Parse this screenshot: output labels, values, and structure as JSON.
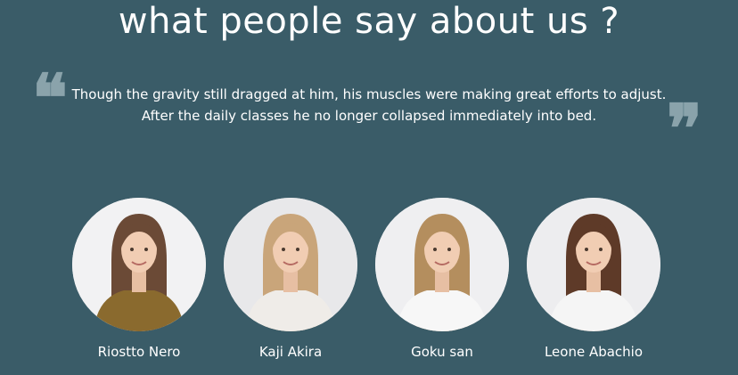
{
  "section": {
    "title": "what people say about us ?",
    "quote": "Though the gravity still dragged at him, his muscles were making great efforts to adjust. After the daily classes he no longer collapsed immediately into bed."
  },
  "colors": {
    "background": "#3a5c68",
    "quote_mark": "#8aa3ab",
    "text": "#ffffff"
  },
  "icons": {
    "open_quote": "quote-open-icon",
    "close_quote": "quote-close-icon"
  },
  "testimonials": [
    {
      "name": "Riostto Nero",
      "hair": "#6b4a36",
      "top": "#8a6a2e",
      "bg": "#f2f2f3"
    },
    {
      "name": "Kaji Akira",
      "hair": "#c9a57a",
      "top": "#efece8",
      "bg": "#e8e8ea"
    },
    {
      "name": "Goku san",
      "hair": "#b48e5e",
      "top": "#f7f7f7",
      "bg": "#efeff1"
    },
    {
      "name": "Leone Abachio",
      "hair": "#5e3a28",
      "top": "#f5f5f5",
      "bg": "#ededef"
    }
  ]
}
